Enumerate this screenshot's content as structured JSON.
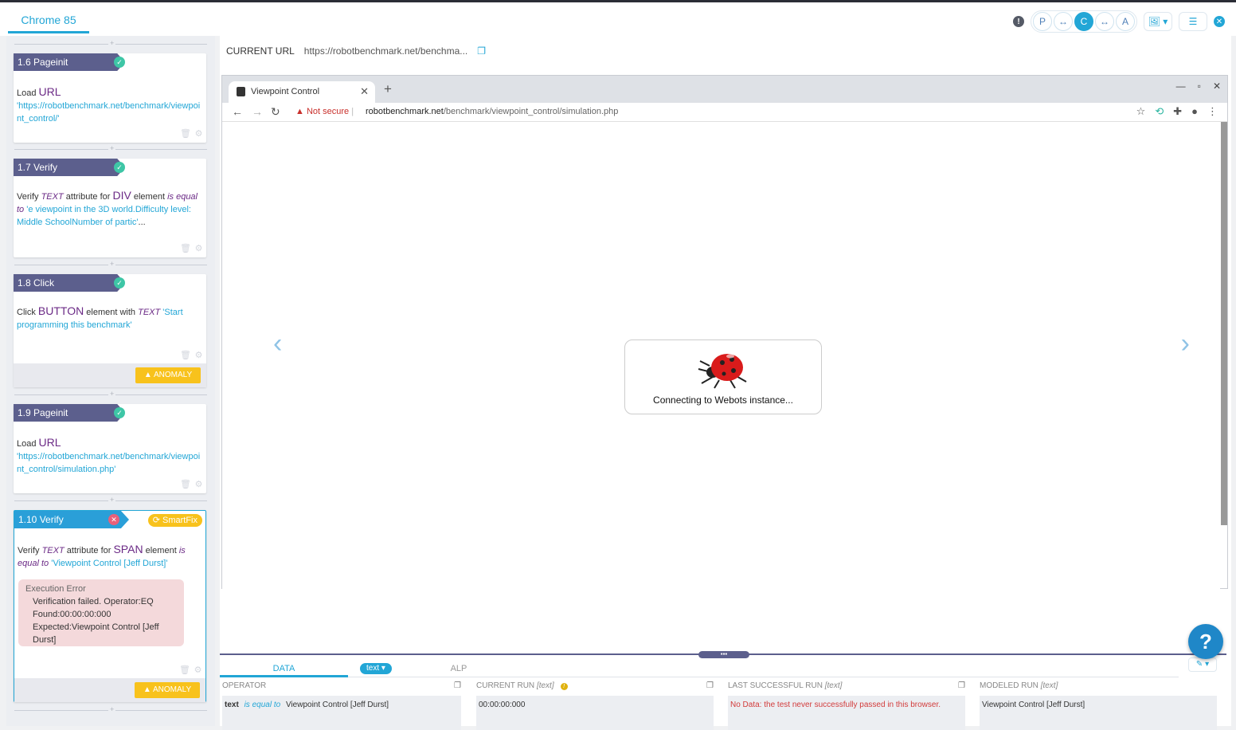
{
  "header": {
    "browser_tab": "Chrome 85",
    "mode_buttons": [
      "P",
      "↔",
      "C",
      "↔",
      "A"
    ],
    "accent": "#22a6d6"
  },
  "steps": [
    {
      "title": "1.6 Pageinit",
      "verb": "Load",
      "kw": "URL",
      "value": "'https://robotbenchmark.net/benchmark/viewpoint_control/'"
    },
    {
      "title": "1.7 Verify",
      "verb": "Verify",
      "attr": "TEXT",
      "attr_for": "attribute for",
      "kw": "DIV",
      "element": "element",
      "op": "is equal to",
      "value": "'e viewpoint in the 3D world.Difficulty level: Middle SchoolNumber of partic'",
      "ellipsis": "..."
    },
    {
      "title": "1.8 Click",
      "verb": "Click",
      "kw": "BUTTON",
      "element_with": "element with",
      "attr": "TEXT",
      "value": "'Start programming this benchmark'",
      "anomaly": "ANOMALY"
    },
    {
      "title": "1.9 Pageinit",
      "verb": "Load",
      "kw": "URL",
      "value": "'https://robotbenchmark.net/benchmark/viewpoint_control/simulation.php'"
    },
    {
      "title": "1.10 Verify",
      "smartfix": "SmartFix",
      "verb": "Verify",
      "attr": "TEXT",
      "attr_for": "attribute for",
      "kw": "SPAN",
      "element": "element",
      "op": "is equal to",
      "value": "'Viewpoint Control [Jeff Durst]'",
      "error_title": "Execution Error",
      "error_lines": [
        "Verification failed. Operator:EQ",
        "Found:00:00:00:000",
        "Expected:Viewpoint Control [Jeff Durst]"
      ],
      "anomaly": "ANOMALY"
    }
  ],
  "current_url": {
    "label": "CURRENT URL",
    "value": "https://robotbenchmark.net/benchma..."
  },
  "browser": {
    "tab_title": "Viewpoint Control",
    "not_secure": "Not secure",
    "address_host": "robotbenchmark.net",
    "address_path": "/benchmark/viewpoint_control/simulation.php",
    "connecting": "Connecting to Webots instance..."
  },
  "bottom": {
    "tabs": [
      "DATA",
      "ALP"
    ],
    "chip": "text",
    "columns": [
      {
        "head": "OPERATOR",
        "tag": "",
        "body_strong": "text",
        "body_op": "is equal to",
        "body": "Viewpoint Control [Jeff Durst]"
      },
      {
        "head": "CURRENT RUN",
        "tag": "[text]",
        "body": "00:00:00:000"
      },
      {
        "head": "LAST SUCCESSFUL RUN",
        "tag": "[text]",
        "body": "No Data: the test never successfully passed in this browser."
      },
      {
        "head": "MODELED RUN",
        "tag": "[text]",
        "body": "Viewpoint Control [Jeff Durst]"
      }
    ]
  }
}
